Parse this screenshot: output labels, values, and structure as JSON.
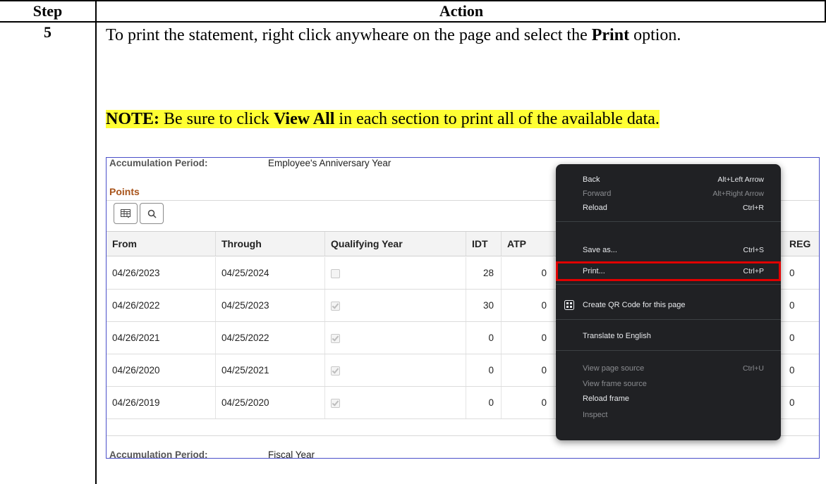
{
  "header": {
    "step": "Step",
    "action": "Action"
  },
  "step_number": "5",
  "instruction": {
    "part1": "To print the statement, right click anywheare on the page and select the ",
    "bold": "Print",
    "part2": " option."
  },
  "note": {
    "label": "NOTE:",
    "part1": " Be sure to click ",
    "bold": "View All",
    "part2": " in each section to print all of the available data."
  },
  "screenshot": {
    "accumulation1": {
      "label": "Accumulation Period:",
      "value": "Employee's Anniversary Year"
    },
    "points_title": "Points",
    "toolbar": {
      "grid_icon": "grid-settings-icon",
      "search_icon": "search-icon"
    },
    "columns": [
      "From",
      "Through",
      "Qualifying Year",
      "IDT",
      "ATP",
      "REG"
    ],
    "rows": [
      {
        "from": "04/26/2023",
        "through": "04/25/2024",
        "qualifying": false,
        "idt": "28",
        "atp": "0",
        "reg": "0"
      },
      {
        "from": "04/26/2022",
        "through": "04/25/2023",
        "qualifying": true,
        "idt": "30",
        "atp": "0",
        "reg": "0"
      },
      {
        "from": "04/26/2021",
        "through": "04/25/2022",
        "qualifying": true,
        "idt": "0",
        "atp": "0",
        "reg": "0"
      },
      {
        "from": "04/26/2020",
        "through": "04/25/2021",
        "qualifying": true,
        "idt": "0",
        "atp": "0",
        "reg": "0"
      },
      {
        "from": "04/26/2019",
        "through": "04/25/2020",
        "qualifying": true,
        "idt": "0",
        "atp": "0",
        "reg": "0"
      }
    ],
    "accumulation2": {
      "label": "Accumulation Period:",
      "value": "Fiscal Year"
    }
  },
  "context_menu": {
    "items": [
      {
        "label": "Back",
        "shortcut": "Alt+Left Arrow",
        "disabled": false
      },
      {
        "label": "Forward",
        "shortcut": "Alt+Right Arrow",
        "disabled": true
      },
      {
        "label": "Reload",
        "shortcut": "Ctrl+R",
        "disabled": false
      },
      {
        "label": "Save as...",
        "shortcut": "Ctrl+S",
        "disabled": false
      },
      {
        "label": "Print...",
        "shortcut": "Ctrl+P",
        "disabled": false,
        "highlighted": true
      },
      {
        "label": "Create QR Code for this page",
        "shortcut": "",
        "disabled": false,
        "icon": "qr-code-icon"
      },
      {
        "label": "Translate to English",
        "shortcut": "",
        "disabled": false
      },
      {
        "label": "View page source",
        "shortcut": "Ctrl+U",
        "disabled": true
      },
      {
        "label": "View frame source",
        "shortcut": "",
        "disabled": true
      },
      {
        "label": "Reload frame",
        "shortcut": "",
        "disabled": false
      },
      {
        "label": "Inspect",
        "shortcut": "",
        "disabled": true
      }
    ],
    "highlight_color": "#e00000"
  },
  "colors": {
    "note_highlight": "#ffff33",
    "points_title": "#a8541b",
    "menu_bg": "#202124"
  }
}
